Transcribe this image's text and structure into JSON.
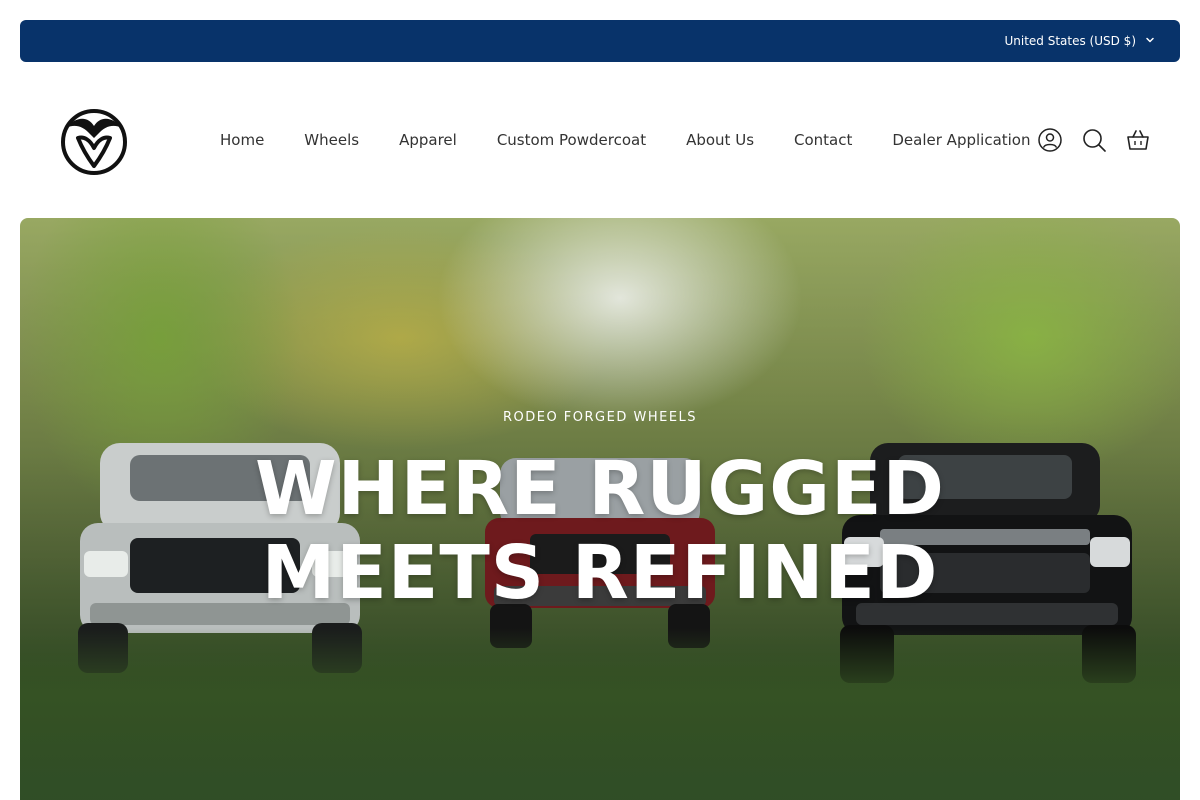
{
  "topbar": {
    "currency_label": "United States (USD $)",
    "bg_color": "#08336a"
  },
  "header": {
    "logo_icon": "bull-head-logo-icon",
    "nav": [
      {
        "label": "Home"
      },
      {
        "label": "Wheels"
      },
      {
        "label": "Apparel"
      },
      {
        "label": "Custom Powdercoat"
      },
      {
        "label": "About Us"
      },
      {
        "label": "Contact"
      },
      {
        "label": "Dealer Application"
      }
    ],
    "icons": [
      "account-icon",
      "search-icon",
      "cart-icon"
    ]
  },
  "hero": {
    "eyebrow": "RODEO FORGED WHEELS",
    "headline_line1": "WHERE RUGGED",
    "headline_line2": "MEETS REFINED"
  }
}
